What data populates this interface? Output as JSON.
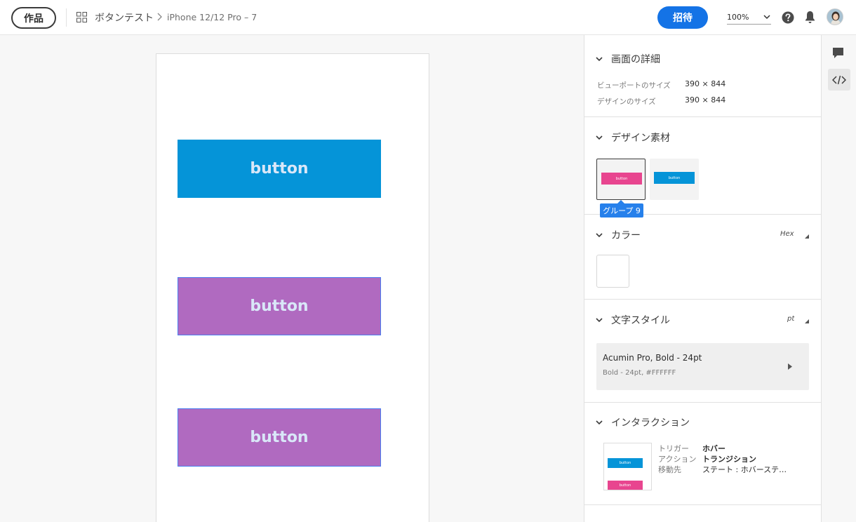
{
  "header": {
    "works_label": "作品",
    "project_name": "ボタンテスト",
    "screen_name": "iPhone 12/12 Pro – 7",
    "invite_label": "招待",
    "zoom": "100%"
  },
  "artboard": {
    "buttons": [
      {
        "label": "button",
        "color": "#0594d8"
      },
      {
        "label": "button",
        "color": "#b06ac0"
      },
      {
        "label": "button",
        "color": "#b06ac0"
      }
    ]
  },
  "panel": {
    "screen_details": {
      "title": "画面の詳細",
      "viewport_label": "ビューポートのサイズ",
      "viewport_value": "390 × 844",
      "design_label": "デザインのサイズ",
      "design_value": "390 × 844"
    },
    "assets": {
      "title": "デザイン素材",
      "items": [
        {
          "label": "button",
          "color": "#e8458f"
        },
        {
          "label": "button",
          "color": "#0594d8"
        }
      ],
      "tooltip": "グループ 9"
    },
    "colors": {
      "title": "カラー",
      "unit": "Hex",
      "swatch": "#FFFFFF"
    },
    "text_styles": {
      "title": "文字スタイル",
      "unit": "pt",
      "style_name": "Acumin Pro, Bold - 24pt",
      "style_detail": "Bold - 24pt, #FFFFFF"
    },
    "interactions": {
      "title": "インタラクション",
      "thumb_labels": [
        "button",
        "button"
      ],
      "trigger_label": "トリガー",
      "trigger_value": "ホバー",
      "action_label": "アクション",
      "action_value": "トランジション",
      "destination_label": "移動先",
      "destination_value": "ステート : ホバーステ…"
    }
  },
  "rail": {
    "icons": [
      "comment-icon",
      "code-icon"
    ]
  },
  "colors": {
    "accent": "#1473e6",
    "tooltip": "#2680eb",
    "button_blue": "#0594d8",
    "button_purple": "#b06ac0",
    "button_pink": "#e8458f"
  }
}
